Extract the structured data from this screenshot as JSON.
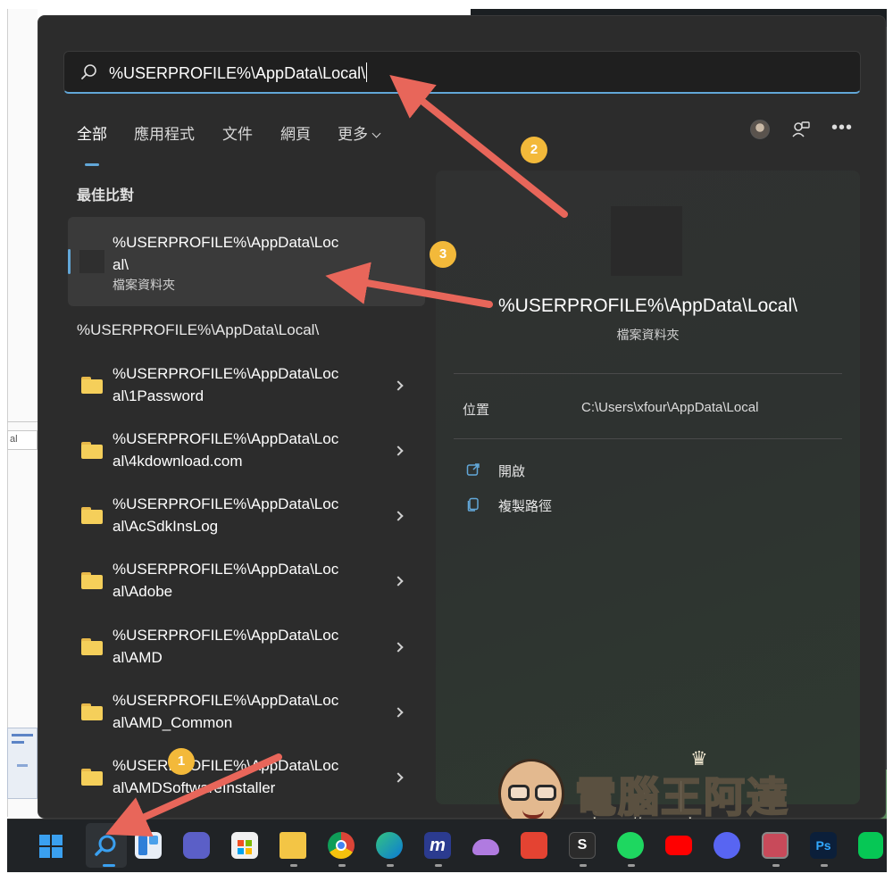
{
  "search": {
    "query": "%USERPROFILE%\\AppData\\Local\\"
  },
  "tabs": [
    {
      "label": "全部"
    },
    {
      "label": "應用程式"
    },
    {
      "label": "文件"
    },
    {
      "label": "網頁"
    },
    {
      "label": "更多"
    }
  ],
  "best_match": {
    "section_label": "最佳比對",
    "title_line1": "%USERPROFILE%\\AppData\\Loc",
    "title_line2": "al\\",
    "subtitle": "檔案資料夾"
  },
  "results_header": "%USERPROFILE%\\AppData\\Local\\",
  "results": [
    {
      "line1": "%USERPROFILE%\\AppData\\Loc",
      "line2": "al\\1Password"
    },
    {
      "line1": "%USERPROFILE%\\AppData\\Loc",
      "line2": "al\\4kdownload.com"
    },
    {
      "line1": "%USERPROFILE%\\AppData\\Loc",
      "line2": "al\\AcSdkInsLog"
    },
    {
      "line1": "%USERPROFILE%\\AppData\\Loc",
      "line2": "al\\Adobe"
    },
    {
      "line1": "%USERPROFILE%\\AppData\\Loc",
      "line2": "al\\AMD"
    },
    {
      "line1": "%USERPROFILE%\\AppData\\Loc",
      "line2": "al\\AMD_Common"
    },
    {
      "line1": "%USERPROFILE%\\AppData\\Loc",
      "line2": "al\\AMDSoftwareInstaller"
    }
  ],
  "detail": {
    "title": "%USERPROFILE%\\AppData\\Local\\",
    "subtitle": "檔案資料夾",
    "location_label": "位置",
    "location_value": "C:\\Users\\xfour\\AppData\\Local",
    "actions": [
      {
        "label": "開啟",
        "icon": "open-external-icon"
      },
      {
        "label": "複製路徑",
        "icon": "copy-path-icon"
      }
    ]
  },
  "annotations": {
    "badge1": "1",
    "badge2": "2",
    "badge3": "3",
    "badge_color": "#f3b93a",
    "arrow_color": "#e8665a"
  },
  "watermark": {
    "brand": "電腦王阿達",
    "url": "http://www.kocpc.com.tw"
  },
  "taskbar": {
    "icons": [
      "windows-start-icon",
      "search-icon",
      "widgets-icon",
      "teams-chat-icon",
      "store-icon",
      "file-explorer-icon",
      "chrome-icon",
      "edge-icon",
      "app-m-icon",
      "onedrive-icon",
      "todoist-icon",
      "s-app-icon",
      "spotify-icon",
      "youtube-icon",
      "discord-icon",
      "screen-recorder-icon",
      "photoshop-icon",
      "line-icon"
    ],
    "accent": "#3aa0f0"
  }
}
